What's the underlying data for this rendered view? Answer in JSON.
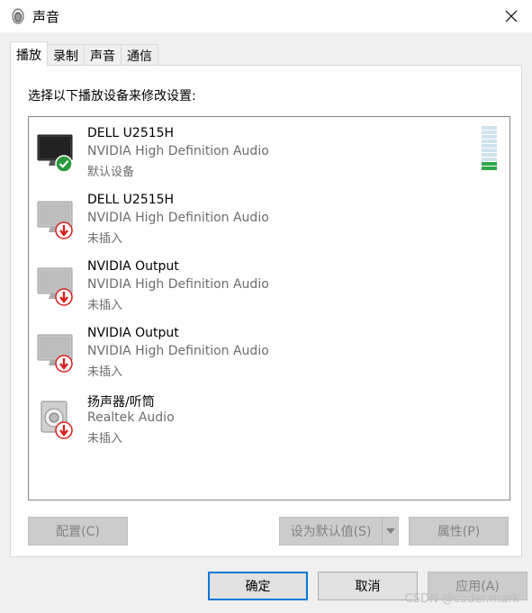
{
  "window": {
    "title": "声音",
    "icon": "speaker-icon"
  },
  "tabs": [
    {
      "label": "播放",
      "active": true
    },
    {
      "label": "录制",
      "active": false
    },
    {
      "label": "声音",
      "active": false
    },
    {
      "label": "通信",
      "active": false
    }
  ],
  "panel": {
    "instruction": "选择以下播放设备来修改设置:"
  },
  "devices": [
    {
      "name": "DELL U2515H",
      "driver": "NVIDIA High Definition Audio",
      "status": "默认设备",
      "icon": "monitor-icon",
      "badge": "check-badge-icon"
    },
    {
      "name": "DELL U2515H",
      "driver": "NVIDIA High Definition Audio",
      "status": "未插入",
      "icon": "monitor-icon",
      "badge": "unplugged-badge-icon"
    },
    {
      "name": "NVIDIA Output",
      "driver": "NVIDIA High Definition Audio",
      "status": "未插入",
      "icon": "monitor-icon",
      "badge": "unplugged-badge-icon"
    },
    {
      "name": "NVIDIA Output",
      "driver": "NVIDIA High Definition Audio",
      "status": "未插入",
      "icon": "monitor-icon",
      "badge": "unplugged-badge-icon"
    },
    {
      "name": "扬声器/听筒",
      "driver": "Realtek Audio",
      "status": "未插入",
      "icon": "speaker-device-icon",
      "badge": "unplugged-badge-icon"
    }
  ],
  "level_meter": {
    "segments": 10,
    "active": 2
  },
  "buttons": {
    "configure": "配置(C)",
    "set_default": "设为默认值(S)",
    "properties": "属性(P)",
    "ok": "确定",
    "cancel": "取消",
    "apply": "应用(A)"
  },
  "watermark": "CSDN @coder.mark",
  "colors": {
    "accent": "#0078d7",
    "check_green": "#2a9a3c",
    "unplugged_red": "#d9201e",
    "meter_on": "#2fa84a"
  }
}
